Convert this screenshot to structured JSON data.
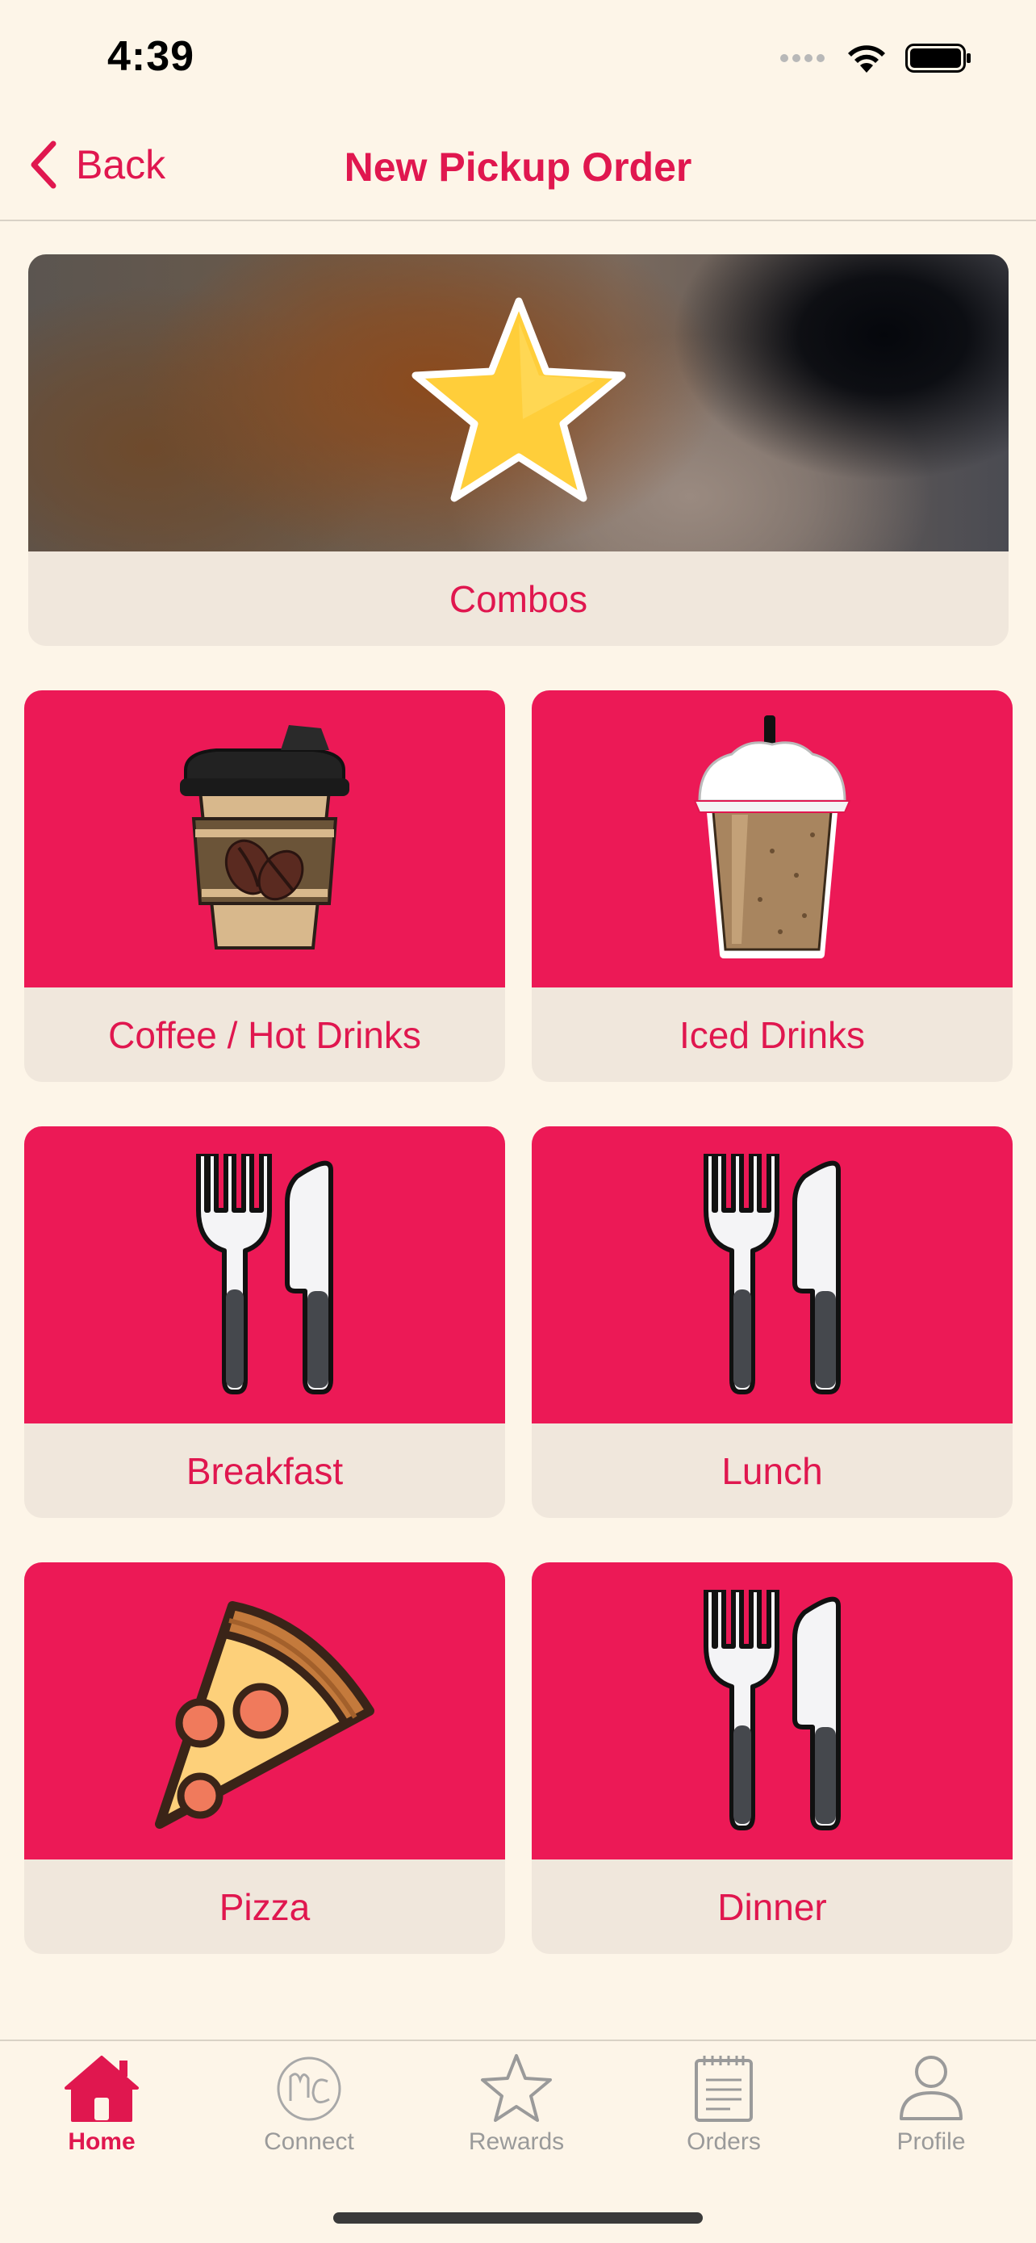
{
  "status_bar": {
    "time": "4:39"
  },
  "nav": {
    "back_label": "Back",
    "title": "New Pickup Order"
  },
  "categories": [
    {
      "label": "Combos",
      "icon": "star-icon"
    },
    {
      "label": "Coffee / Hot Drinks",
      "icon": "coffee-cup-icon"
    },
    {
      "label": "Iced Drinks",
      "icon": "iced-drink-icon"
    },
    {
      "label": "Breakfast",
      "icon": "fork-knife-icon"
    },
    {
      "label": "Lunch",
      "icon": "fork-knife-icon"
    },
    {
      "label": "Pizza",
      "icon": "pizza-slice-icon"
    },
    {
      "label": "Dinner",
      "icon": "fork-knife-icon"
    }
  ],
  "tab_bar": {
    "tabs": [
      {
        "label": "Home",
        "icon": "home-icon",
        "active": true
      },
      {
        "label": "Connect",
        "icon": "mc-logo-icon",
        "active": false
      },
      {
        "label": "Rewards",
        "icon": "star-outline-icon",
        "active": false
      },
      {
        "label": "Orders",
        "icon": "notepad-icon",
        "active": false
      },
      {
        "label": "Profile",
        "icon": "person-icon",
        "active": false
      }
    ]
  },
  "colors": {
    "accent": "#E0174F",
    "card_image_bg": "#EC1956",
    "card_label_bg": "#F0E7DC",
    "page_bg": "#FDF5E8",
    "inactive_tab": "#9A9A9A"
  }
}
